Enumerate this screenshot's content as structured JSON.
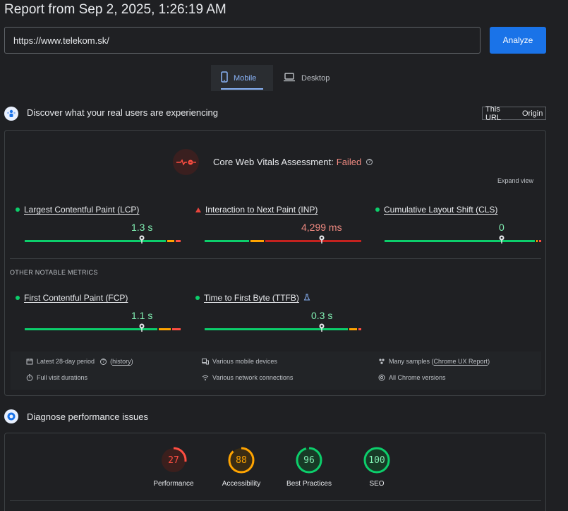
{
  "report": {
    "title": "Report from Sep 2, 2025, 1:26:19 AM"
  },
  "url_bar": {
    "value": "https://www.telekom.sk/",
    "analyze_label": "Analyze"
  },
  "device_tabs": [
    {
      "label": "Mobile",
      "selected": true,
      "icon": "smartphone-icon"
    },
    {
      "label": "Desktop",
      "selected": false,
      "icon": "laptop-icon"
    }
  ],
  "field_section": {
    "heading": "Discover what your real users are experiencing",
    "toggle": {
      "this_url": "This URL",
      "origin": "Origin",
      "selected": "This URL"
    },
    "assessment": {
      "label": "Core Web Vitals Assessment:",
      "status": "Failed"
    },
    "expand_view": "Expand view",
    "core_metrics": [
      {
        "name": "Largest Contentful Paint (LCP)",
        "value": "1.3 s",
        "rating": "good",
        "marker": 0.75
      },
      {
        "name": "Interaction to Next Paint (INP)",
        "value": "4,299 ms",
        "rating": "poor",
        "marker": 0.75
      },
      {
        "name": "Cumulative Layout Shift (CLS)",
        "value": "0",
        "rating": "good",
        "marker": 0.75
      }
    ],
    "other_metrics_heading": "OTHER NOTABLE METRICS",
    "other_metrics": [
      {
        "name": "First Contentful Paint (FCP)",
        "value": "1.1 s",
        "rating": "good",
        "marker": 0.75
      },
      {
        "name": "Time to First Byte (TTFB)",
        "value": "0.3 s",
        "rating": "good",
        "marker": 0.75,
        "experimental": true
      }
    ],
    "info": {
      "period": "Latest 28-day period",
      "history_link": "history",
      "visit": "Full visit durations",
      "devices": "Various mobile devices",
      "network": "Various network connections",
      "samples_prefix": "Many samples (",
      "samples_link": "Chrome UX Report",
      "samples_suffix": ")",
      "versions": "All Chrome versions"
    }
  },
  "lab_section": {
    "heading": "Diagnose performance issues",
    "scores": [
      {
        "label": "Performance",
        "value": "27",
        "color": "#ff4e42"
      },
      {
        "label": "Accessibility",
        "value": "88",
        "color": "#ffa400"
      },
      {
        "label": "Best Practices",
        "value": "96",
        "color": "#0cce6b"
      },
      {
        "label": "SEO",
        "value": "100",
        "color": "#0cce6b"
      }
    ]
  },
  "colors": {
    "good": "#0cce6b",
    "needs_improvement": "#ffa400",
    "poor": "#ff4e42",
    "accent": "#1a73e8"
  }
}
